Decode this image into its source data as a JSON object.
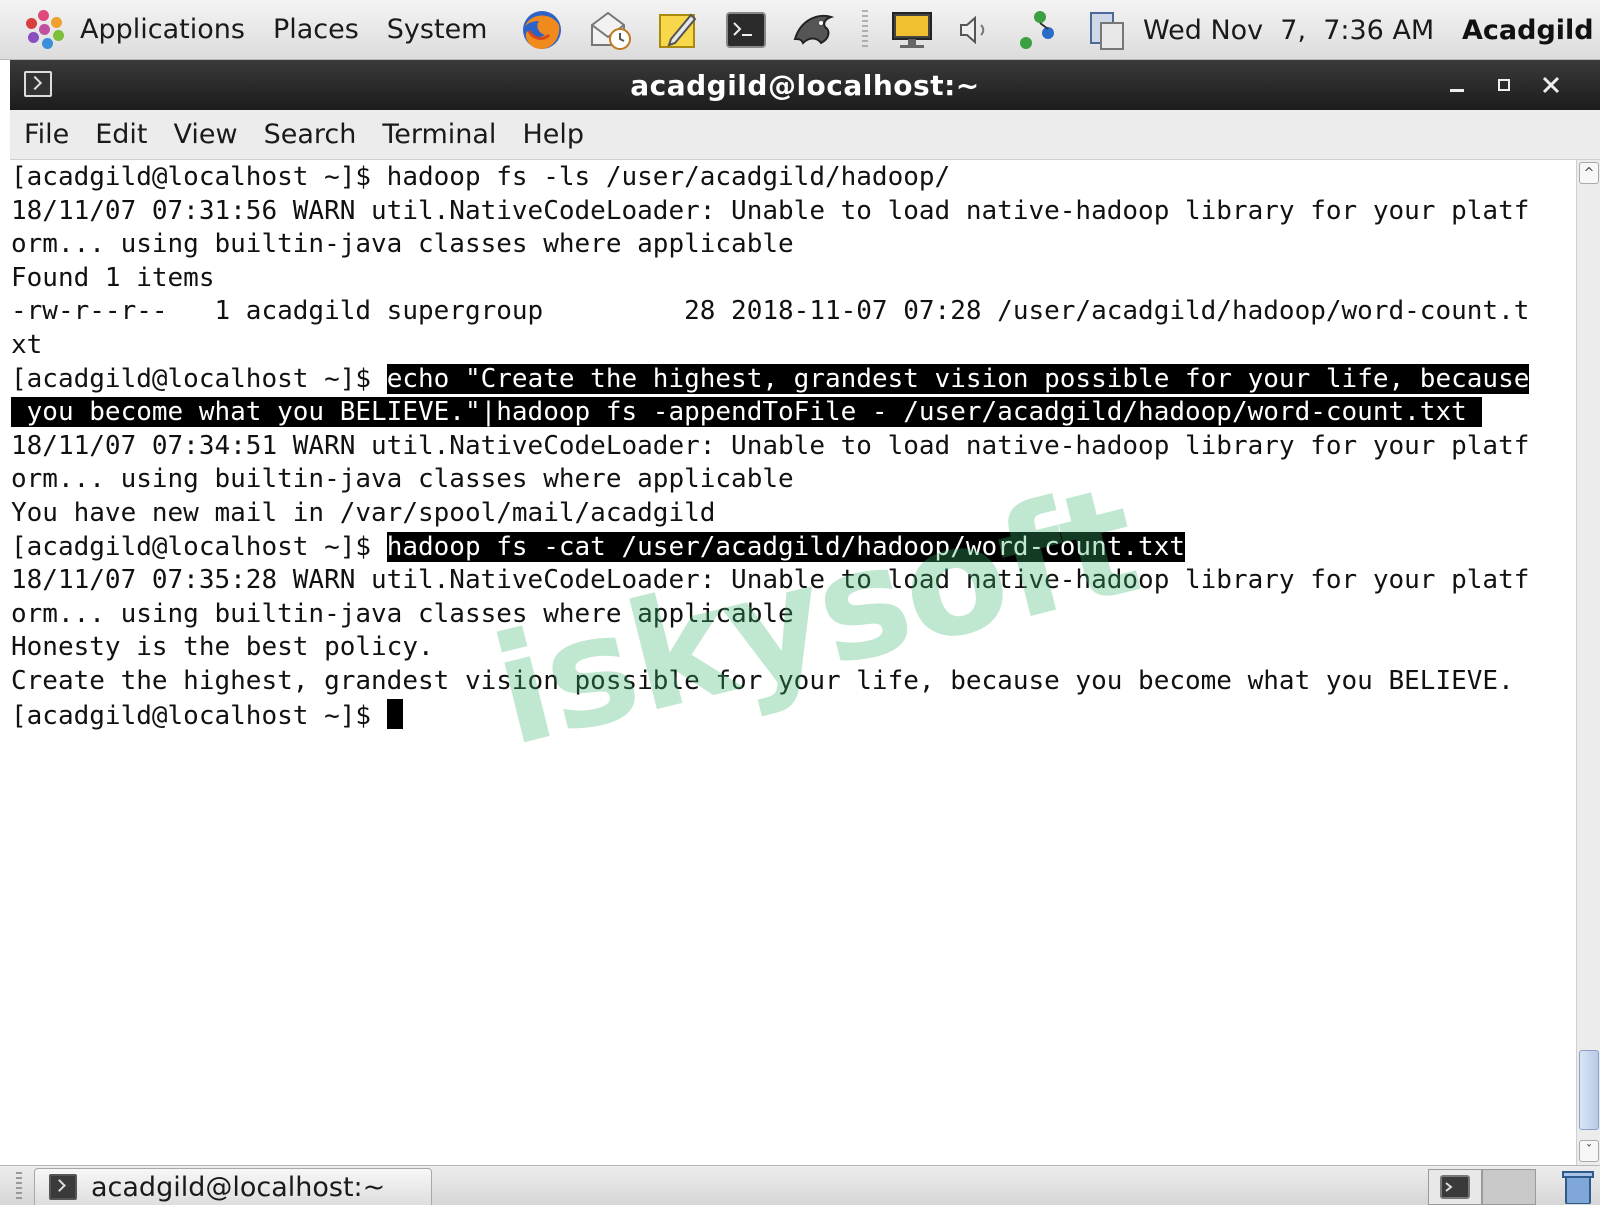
{
  "top_panel": {
    "menus": [
      "Applications",
      "Places",
      "System"
    ],
    "clock": "Wed Nov  7,  7:36 AM",
    "user": "Acadgild"
  },
  "window": {
    "title": "acadgild@localhost:~",
    "menu": [
      "File",
      "Edit",
      "View",
      "Search",
      "Terminal",
      "Help"
    ]
  },
  "terminal": {
    "lines": [
      "[acadgild@localhost ~]$ hadoop fs -ls /user/acadgild/hadoop/",
      "18/11/07 07:31:56 WARN util.NativeCodeLoader: Unable to load native-hadoop library for your platf",
      "orm... using builtin-java classes where applicable",
      "Found 1 items",
      "-rw-r--r--   1 acadgild supergroup         28 2018-11-07 07:28 /user/acadgild/hadoop/word-count.t",
      "xt",
      "[acadgild@localhost ~]$ ",
      "echo \"Create the highest, grandest vision possible for your life, because",
      " you become what you BELIEVE.\"|hadoop fs -appendToFile - /user/acadgild/hadoop/word-count.txt ",
      "18/11/07 07:34:51 WARN util.NativeCodeLoader: Unable to load native-hadoop library for your platf",
      "orm... using builtin-java classes where applicable",
      "You have new mail in /var/spool/mail/acadgild",
      "[acadgild@localhost ~]$ ",
      "hadoop fs -cat /user/acadgild/hadoop/word-count.txt",
      "18/11/07 07:35:28 WARN util.NativeCodeLoader: Unable to load native-hadoop library for your platf",
      "orm... using builtin-java classes where applicable",
      "Honesty is the best policy.",
      "Create the highest, grandest vision possible for your life, because you become what you BELIEVE.",
      "[acadgild@localhost ~]$ "
    ]
  },
  "watermark": "iskysoft",
  "taskbar": {
    "task_label": "acadgild@localhost:~"
  },
  "colors": {
    "titlebar": "#1c1c1c",
    "selection_bg": "#000000",
    "watermark": "#3cb46e"
  }
}
